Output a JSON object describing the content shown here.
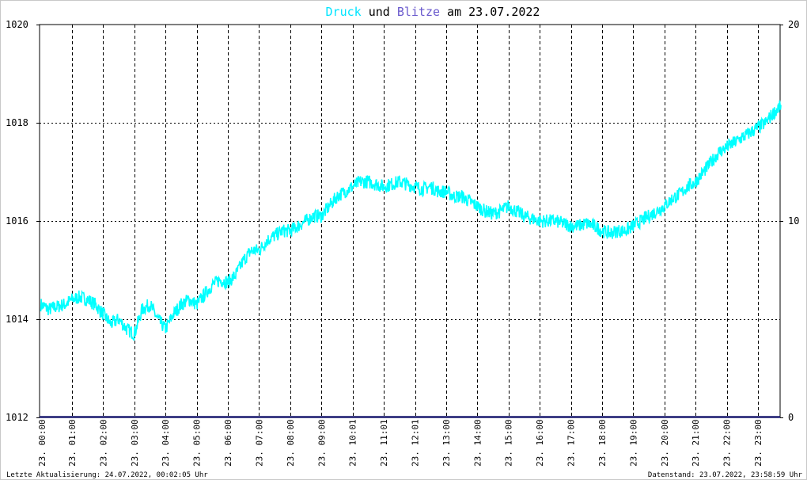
{
  "chart_data": {
    "type": "line",
    "title": {
      "part1": "Druck",
      "part2": " und ",
      "part3": "Blitze",
      "part4": " am 23.07.2022"
    },
    "y_left": {
      "min": 1012,
      "max": 1020,
      "ticks": [
        "1012",
        "1014",
        "1016",
        "1018",
        "1020"
      ]
    },
    "y_right": {
      "min": 0,
      "max": 20,
      "ticks": [
        "0",
        "10",
        "20"
      ]
    },
    "x_min": 0,
    "x_max": 24,
    "x_ticks": [
      {
        "t": 0.0,
        "label": "23. 00:00"
      },
      {
        "t": 1.0,
        "label": "23. 01:00"
      },
      {
        "t": 2.0,
        "label": "23. 02:00"
      },
      {
        "t": 3.0,
        "label": "23. 03:00"
      },
      {
        "t": 4.0,
        "label": "23. 04:00"
      },
      {
        "t": 5.0,
        "label": "23. 05:00"
      },
      {
        "t": 6.0,
        "label": "23. 06:00"
      },
      {
        "t": 7.0,
        "label": "23. 07:00"
      },
      {
        "t": 8.0,
        "label": "23. 08:00"
      },
      {
        "t": 9.0,
        "label": "23. 09:00"
      },
      {
        "t": 10.0,
        "label": "23. 10:01"
      },
      {
        "t": 11.0,
        "label": "23. 11:01"
      },
      {
        "t": 12.0,
        "label": "23. 12:01"
      },
      {
        "t": 13.0,
        "label": "23. 13:00"
      },
      {
        "t": 14.0,
        "label": "23. 14:00"
      },
      {
        "t": 15.0,
        "label": "23. 15:00"
      },
      {
        "t": 16.0,
        "label": "23. 16:00"
      },
      {
        "t": 17.0,
        "label": "23. 17:00"
      },
      {
        "t": 18.0,
        "label": "23. 18:00"
      },
      {
        "t": 19.0,
        "label": "23. 19:00"
      },
      {
        "t": 20.0,
        "label": "23. 20:00"
      },
      {
        "t": 21.0,
        "label": "23. 21:00"
      },
      {
        "t": 22.0,
        "label": "23. 22:00"
      },
      {
        "t": 23.0,
        "label": "23. 23:00"
      }
    ],
    "series": [
      {
        "color": "#00ffff",
        "x": [
          0,
          0.25,
          0.5,
          0.75,
          1,
          1.25,
          1.5,
          1.75,
          2,
          2.25,
          2.5,
          2.75,
          3,
          3.25,
          3.5,
          3.75,
          4,
          4.25,
          4.5,
          4.75,
          5,
          5.25,
          5.5,
          5.75,
          6,
          6.25,
          6.5,
          6.75,
          7,
          7.25,
          7.5,
          7.75,
          8,
          8.25,
          8.5,
          8.75,
          9,
          9.25,
          9.5,
          9.75,
          10,
          10.25,
          10.5,
          10.75,
          11,
          11.25,
          11.5,
          11.75,
          12,
          12.25,
          12.5,
          12.75,
          13,
          13.25,
          13.5,
          13.75,
          14,
          14.25,
          14.5,
          14.75,
          15,
          15.25,
          15.5,
          15.75,
          16,
          16.25,
          16.5,
          16.75,
          17,
          17.25,
          17.5,
          17.75,
          18,
          18.25,
          18.5,
          18.75,
          19,
          19.25,
          19.5,
          19.75,
          20,
          20.25,
          20.5,
          20.75,
          21,
          21.25,
          21.5,
          21.75,
          22,
          22.25,
          22.5,
          22.75,
          23,
          23.25,
          23.5,
          23.75
        ],
        "y": [
          1014.3,
          1014.2,
          1014.25,
          1014.3,
          1014.4,
          1014.45,
          1014.4,
          1014.3,
          1014.1,
          1013.9,
          1014.0,
          1013.8,
          1013.7,
          1014.2,
          1014.3,
          1014.0,
          1013.8,
          1014.1,
          1014.3,
          1014.4,
          1014.3,
          1014.5,
          1014.7,
          1014.8,
          1014.75,
          1014.9,
          1015.2,
          1015.4,
          1015.4,
          1015.6,
          1015.7,
          1015.8,
          1015.8,
          1015.9,
          1016.0,
          1016.1,
          1016.1,
          1016.3,
          1016.5,
          1016.6,
          1016.7,
          1016.8,
          1016.8,
          1016.75,
          1016.7,
          1016.75,
          1016.8,
          1016.75,
          1016.7,
          1016.65,
          1016.7,
          1016.6,
          1016.6,
          1016.5,
          1016.5,
          1016.4,
          1016.3,
          1016.2,
          1016.15,
          1016.2,
          1016.3,
          1016.2,
          1016.1,
          1016.05,
          1016.0,
          1016.0,
          1016.0,
          1015.95,
          1015.9,
          1015.9,
          1015.95,
          1015.9,
          1015.8,
          1015.75,
          1015.8,
          1015.8,
          1015.9,
          1016.0,
          1016.1,
          1016.2,
          1016.3,
          1016.45,
          1016.55,
          1016.7,
          1016.8,
          1017.0,
          1017.2,
          1017.4,
          1017.5,
          1017.6,
          1017.7,
          1017.8,
          1017.9,
          1018.0,
          1018.2,
          1018.35
        ]
      },
      {
        "color": "#1a1a6e",
        "x": [
          0,
          24
        ],
        "y": [
          0,
          0
        ]
      }
    ],
    "grid": true
  },
  "footer": {
    "left": "Letzte Aktualisierung: 24.07.2022, 00:02:05 Uhr",
    "right": "Datenstand: 23.07.2022, 23:58:59 Uhr"
  },
  "colors": {
    "druck": "#00e5ff",
    "blitze": "#6a5acd",
    "title_text": "#000000"
  }
}
